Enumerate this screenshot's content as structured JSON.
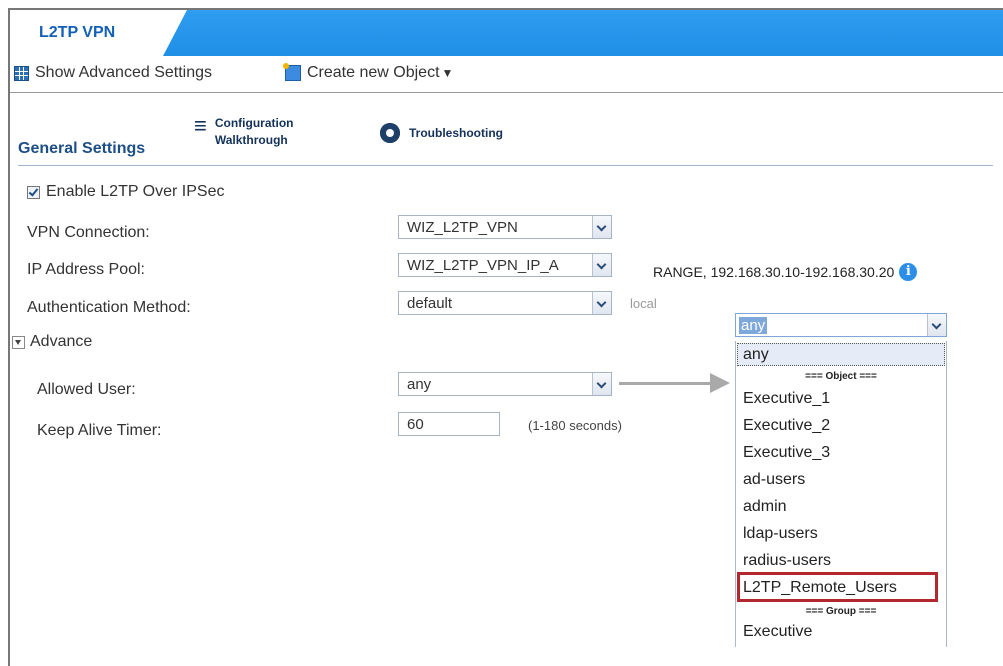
{
  "tab": {
    "title": "L2TP VPN"
  },
  "toolbar": {
    "show_advanced": "Show Advanced Settings",
    "create_object": "Create new Object"
  },
  "general": {
    "title": "General Settings",
    "walkthrough_line1": "Configuration",
    "walkthrough_line2": "Walkthrough",
    "troubleshooting": "Troubleshooting"
  },
  "form": {
    "enable_l2tp": "Enable L2TP Over IPSec",
    "vpn_connection_label": "VPN Connection:",
    "vpn_connection_value": "WIZ_L2TP_VPN",
    "ip_pool_label": "IP Address Pool:",
    "ip_pool_value": "WIZ_L2TP_VPN_IP_A",
    "ip_pool_range": "RANGE, 192.168.30.10-192.168.30.20",
    "auth_label": "Authentication Method:",
    "auth_value": "default",
    "auth_hint": "local",
    "advance": "Advance",
    "allowed_user_label": "Allowed User:",
    "allowed_user_value": "any",
    "keep_alive_label": "Keep Alive Timer:",
    "keep_alive_value": "60",
    "keep_alive_hint": "(1-180 seconds)"
  },
  "dropdown": {
    "selected": "any",
    "first": "any",
    "object_header": "=== Object ===",
    "objects": [
      "Executive_1",
      "Executive_2",
      "Executive_3",
      "ad-users",
      "admin",
      "ldap-users",
      "radius-users",
      "L2TP_Remote_Users"
    ],
    "group_header": "=== Group ===",
    "groups": [
      "Executive"
    ]
  },
  "colors": {
    "tab_bar": "#1f8fe6",
    "highlight": "#b3282e",
    "accent": "#1260b8"
  }
}
